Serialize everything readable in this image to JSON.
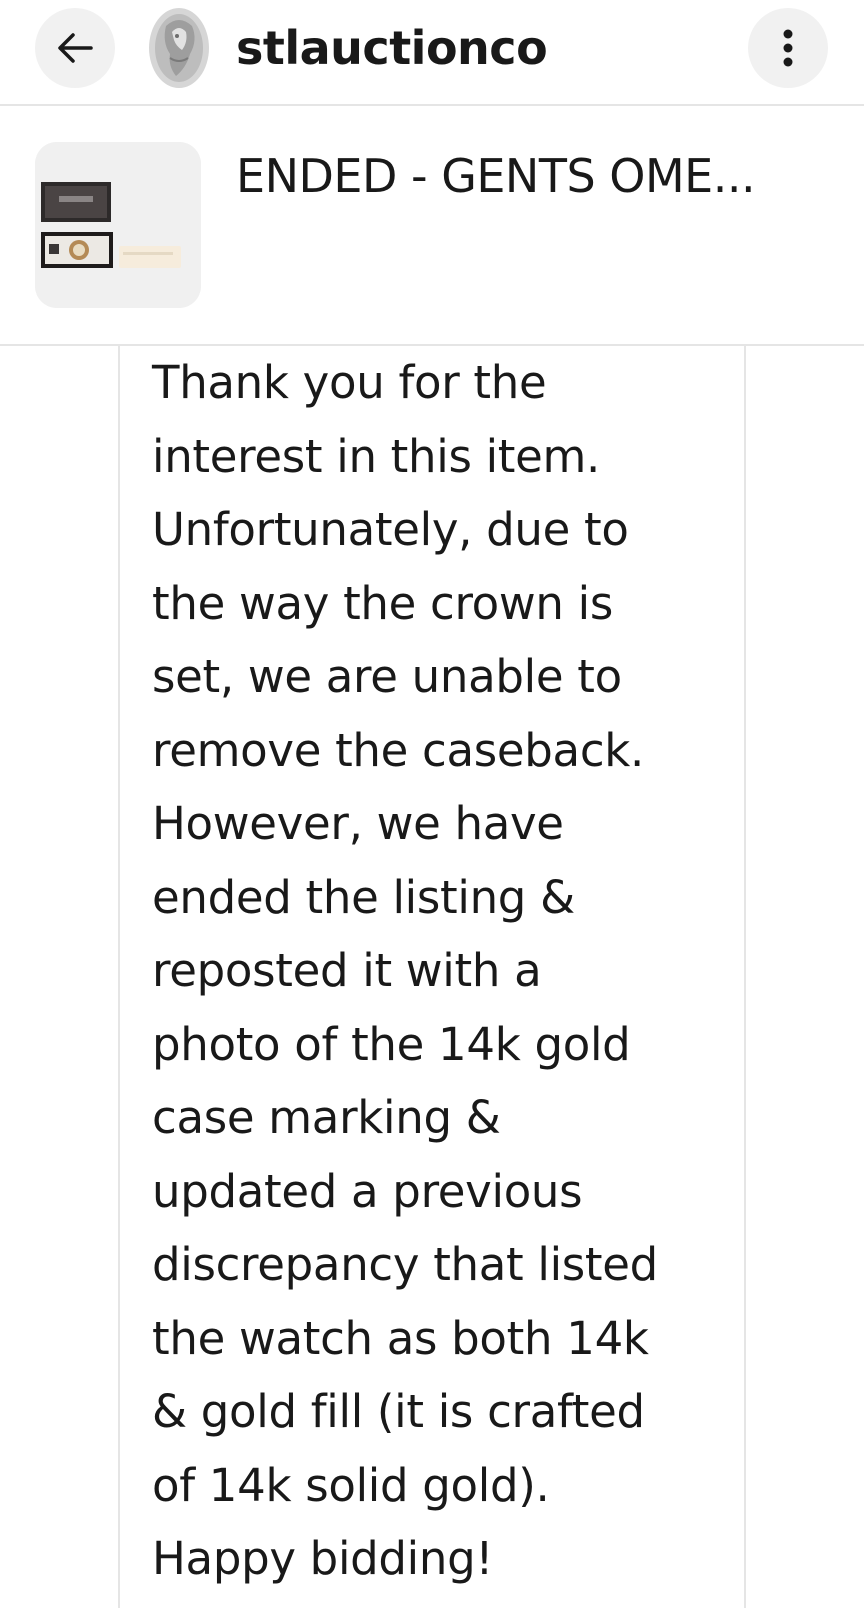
{
  "header": {
    "username": "stlauctionco",
    "back_icon": "arrow-left-icon",
    "more_icon": "vertical-dots-icon"
  },
  "listing": {
    "title": "ENDED - GENTS OME..."
  },
  "message": {
    "text": "Thank you for the\ninterest in this item.\nUnfortunately, due to\nthe way the crown is\nset, we are unable to\nremove the caseback.\nHowever, we have\nended the listing &\nreposted it with a\nphoto of the 14k gold\ncase marking &\nupdated a previous\ndiscrepancy that listed\nthe watch as both 14k\n& gold fill (it is crafted\nof 14k solid gold).\nHappy bidding!"
  }
}
